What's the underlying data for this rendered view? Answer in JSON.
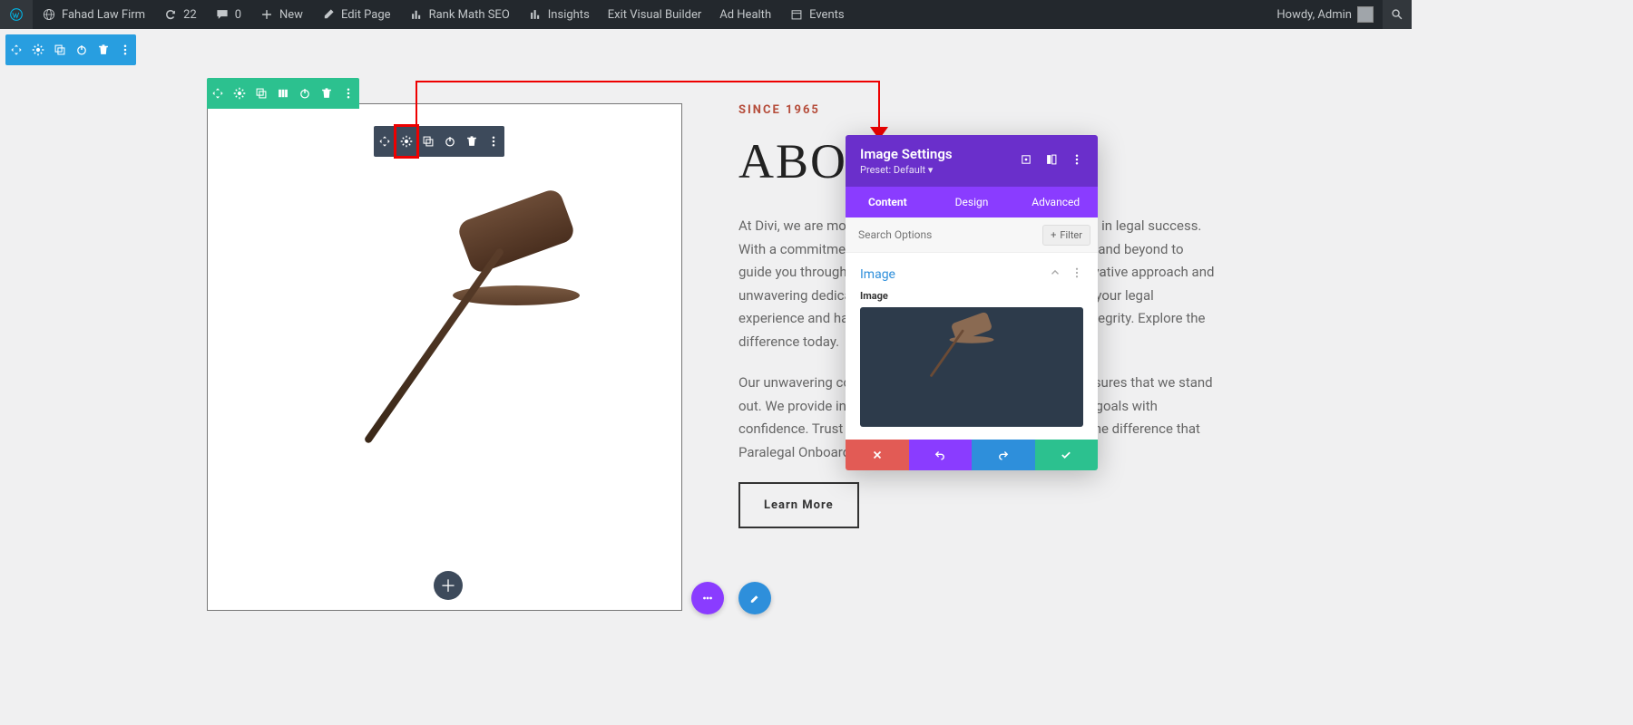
{
  "admin": {
    "site_name": "Fahad Law Firm",
    "updates": "22",
    "comments": "0",
    "new": "New",
    "edit_page": "Edit Page",
    "rank_math": "Rank Math SEO",
    "insights": "Insights",
    "exit_vb": "Exit Visual Builder",
    "ad_health": "Ad Health",
    "events": "Events",
    "howdy": "Howdy, Admin"
  },
  "page": {
    "eyebrow": "SINCE 1965",
    "title": "ABOU",
    "p1": "At Divi, we are more than a legal firm – we are your partners in legal success. With a commitment to unwavering dedication, we go above and beyond to guide you through each step of their legal journey. Our innovative approach and unwavering dedication set us apart, allowing us to redefine your legal experience and handle your matters with confidence and integrity. Explore the difference today.",
    "p2": "Our unwavering commitment to trust, and client support ensures that we stand out. We provide innovative solutions to help you reach your goals with confidence. Trust us for your legal journey and experience the difference that Paralegal Onboarding can make for you.",
    "learn_more": "Learn More"
  },
  "panel": {
    "title": "Image Settings",
    "preset": "Preset: Default ▾",
    "tabs": [
      "Content",
      "Design",
      "Advanced"
    ],
    "search_placeholder": "Search Options",
    "filter": "Filter",
    "section": "Image",
    "field_label": "Image"
  }
}
